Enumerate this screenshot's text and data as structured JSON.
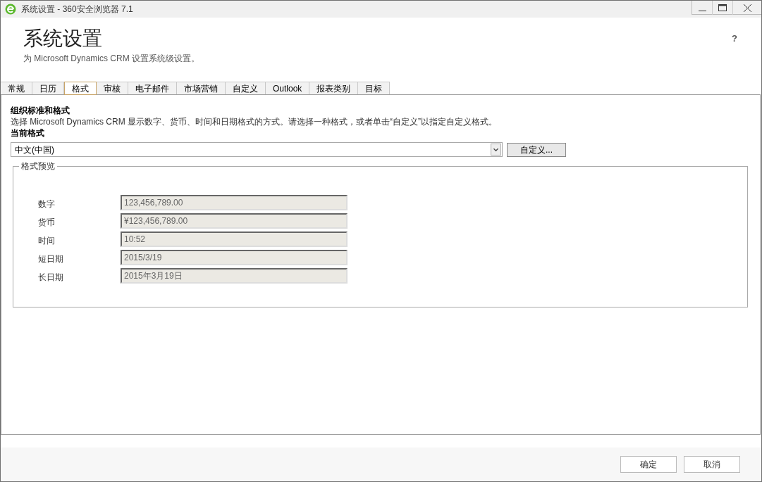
{
  "window": {
    "title": "系统设置 - 360安全浏览器 7.1"
  },
  "header": {
    "title": "系统设置",
    "subtitle": "为 Microsoft Dynamics CRM 设置系统级设置。",
    "help": "?"
  },
  "tabs": [
    {
      "label": "常规",
      "selected": false
    },
    {
      "label": "日历",
      "selected": false
    },
    {
      "label": "格式",
      "selected": true
    },
    {
      "label": "审核",
      "selected": false
    },
    {
      "label": "电子邮件",
      "selected": false
    },
    {
      "label": "市场营销",
      "selected": false
    },
    {
      "label": "自定义",
      "selected": false
    },
    {
      "label": "Outlook",
      "selected": false
    },
    {
      "label": "报表类别",
      "selected": false
    },
    {
      "label": "目标",
      "selected": false
    }
  ],
  "section": {
    "heading": "组织标准和格式",
    "description": "选择 Microsoft Dynamics CRM 显示数字、货币、时间和日期格式的方式。请选择一种格式，或者单击“自定义”以指定自定义格式。",
    "current_label": "当前格式",
    "current_value": "中文(中国)",
    "customize_button": "自定义..."
  },
  "preview": {
    "legend": "格式预览",
    "rows": [
      {
        "label": "数字",
        "value": "123,456,789.00"
      },
      {
        "label": "货币",
        "value": "¥123,456,789.00"
      },
      {
        "label": "时间",
        "value": "10:52"
      },
      {
        "label": "短日期",
        "value": "2015/3/19"
      },
      {
        "label": "长日期",
        "value": "2015年3月19日"
      }
    ]
  },
  "buttons": [
    "确定",
    "取消"
  ]
}
